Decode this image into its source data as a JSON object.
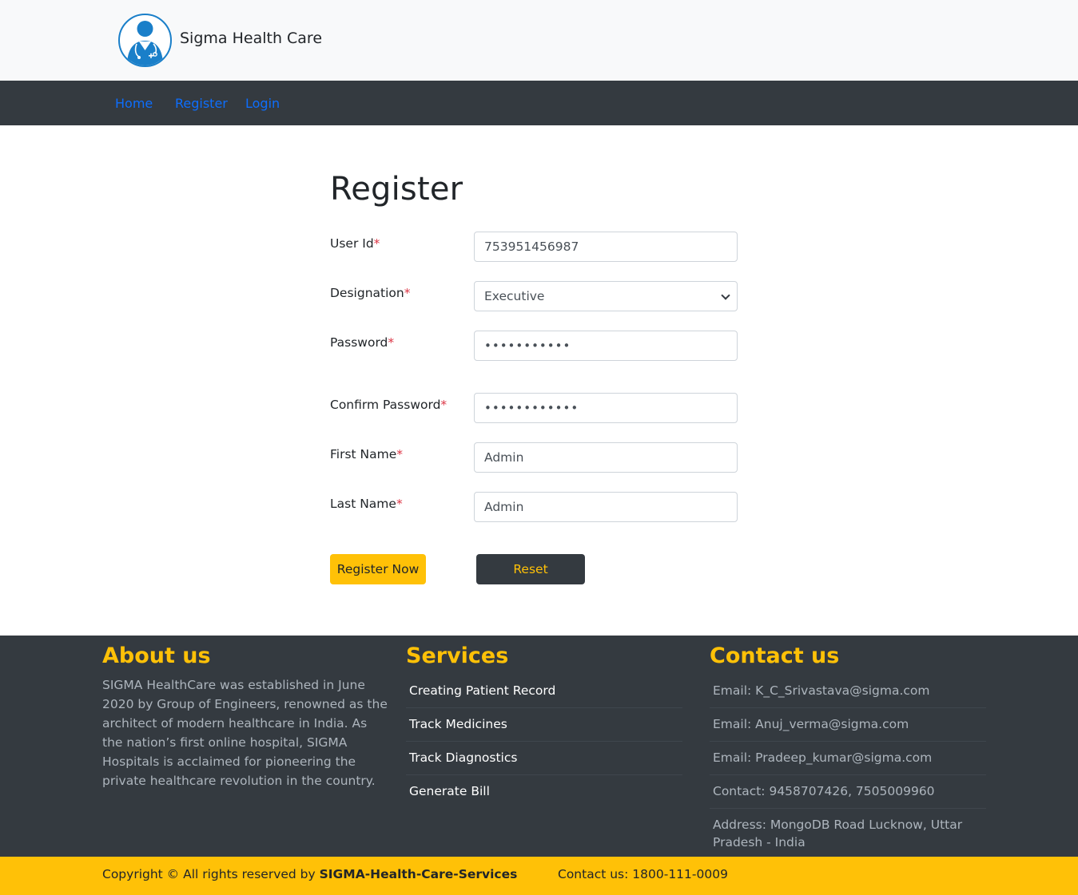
{
  "brand": {
    "name": "Sigma Health Care",
    "logo_icon": "doctor-icon"
  },
  "nav": {
    "items": [
      "Home",
      "Register",
      "Login"
    ]
  },
  "form": {
    "title": "Register",
    "required_mark": "*",
    "fields": {
      "user_id": {
        "label": "User Id",
        "value": "753951456987"
      },
      "designation": {
        "label": "Designation",
        "value": "Executive"
      },
      "password": {
        "label": "Password",
        "value": "•••••••••••"
      },
      "confirm_password": {
        "label": "Confirm Password",
        "value": "••••••••••••"
      },
      "first_name": {
        "label": "First Name",
        "value": "Admin"
      },
      "last_name": {
        "label": "Last Name",
        "value": "Admin"
      }
    },
    "register_button": "Register Now",
    "reset_button": "Reset"
  },
  "footer": {
    "about": {
      "title": "About us",
      "text": "SIGMA HealthCare was established in June 2020 by Group of Engineers, renowned as the architect of modern healthcare in India. As the nation’s first online hospital, SIGMA Hospitals is acclaimed for pioneering the private healthcare revolution in the country."
    },
    "services": {
      "title": "Services",
      "items": [
        "Creating Patient Record",
        "Track Medicines",
        "Track Diagnostics",
        "Generate Bill"
      ]
    },
    "contact": {
      "title": "Contact us",
      "items": [
        "Email: K_C_Srivastava@sigma.com",
        "Email: Anuj_verma@sigma.com",
        "Email: Pradeep_kumar@sigma.com",
        "Contact: 9458707426, 7505009960",
        "Address: MongoDB Road Lucknow, Uttar Pradesh - India"
      ]
    }
  },
  "copyright": {
    "prefix": "Copyright © All rights reserved by ",
    "org": "SIGMA-Health-Care-Services",
    "contact": "Contact us: 1800-111-0009"
  },
  "colors": {
    "accent": "#ffc107",
    "dark": "#343a40",
    "link": "#0d6efd",
    "required": "#dc3545"
  }
}
